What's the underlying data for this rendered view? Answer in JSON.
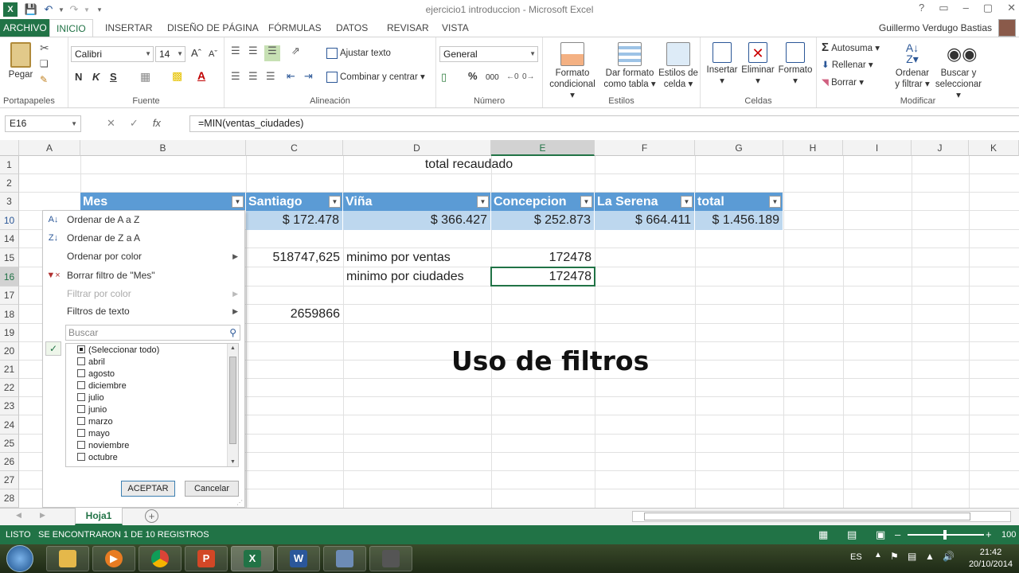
{
  "window": {
    "title": "ejercicio1 introduccion - Microsoft Excel",
    "controls": [
      "?",
      "▭",
      "–",
      "▢",
      "✕"
    ]
  },
  "tabs": [
    "ARCHIVO",
    "INICIO",
    "INSERTAR",
    "DISEÑO DE PÁGINA",
    "FÓRMULAS",
    "DATOS",
    "REVISAR",
    "VISTA"
  ],
  "user": "Guillermo Verdugo Bastias",
  "ribbon": {
    "clipboard": {
      "paste": "Pegar",
      "group": "Portapapeles"
    },
    "font": {
      "name": "Calibri",
      "size": "14",
      "bold": "N",
      "italic": "K",
      "underline": "S",
      "group": "Fuente"
    },
    "alignment": {
      "wrap": "Ajustar texto",
      "merge": "Combinar y centrar",
      "group": "Alineación"
    },
    "number": {
      "format": "General",
      "percent": "%",
      "thousands": "000",
      "group": "Número"
    },
    "styles": {
      "conditional_1": "Formato",
      "conditional_2": "condicional",
      "table_1": "Dar formato",
      "table_2": "como tabla",
      "cell_1": "Estilos de",
      "cell_2": "celda",
      "group": "Estilos"
    },
    "cells": {
      "insert": "Insertar",
      "delete": "Eliminar",
      "format": "Formato",
      "group": "Celdas"
    },
    "editing": {
      "autosum": "Autosuma",
      "fill": "Rellenar",
      "clear": "Borrar",
      "sort_1": "Ordenar",
      "sort_2": "y filtrar",
      "find_1": "Buscar y",
      "find_2": "seleccionar",
      "group": "Modificar"
    }
  },
  "formula_bar": {
    "name_box": "E16",
    "fx": "fx",
    "formula": "=MIN(ventas_ciudades)"
  },
  "columns": [
    "A",
    "B",
    "C",
    "D",
    "E",
    "F",
    "G",
    "H",
    "I",
    "J",
    "K"
  ],
  "rows": [
    "1",
    "2",
    "3",
    "10",
    "14",
    "15",
    "16",
    "17",
    "18",
    "19",
    "20",
    "21",
    "22",
    "23",
    "24",
    "25",
    "26",
    "27",
    "28"
  ],
  "cells": {
    "title": "total recaudado",
    "headers": [
      "Mes",
      "Santiago",
      "Viña",
      "Concepcion",
      "La Serena",
      "total"
    ],
    "totals": [
      "$ 172.478",
      "$ 366.427",
      "$ 252.873",
      "$ 664.411",
      "$ 1.456.189"
    ],
    "c15": "518747,625",
    "d15": "minimo por ventas",
    "e15": "172478",
    "d16": "minimo por ciudades",
    "e16": "172478",
    "c18": "2659866"
  },
  "overlay_text": "Uso de filtros",
  "filter_menu": {
    "sort_az": "Ordenar de A a Z",
    "sort_za": "Ordenar de Z a A",
    "sort_color": "Ordenar por color",
    "clear_filter": "Borrar filtro de \"Mes\"",
    "filter_color": "Filtrar por color",
    "text_filters": "Filtros de texto",
    "search_placeholder": "Buscar",
    "items": [
      "(Seleccionar todo)",
      "abril",
      "agosto",
      "diciembre",
      "julio",
      "junio",
      "marzo",
      "mayo",
      "noviembre",
      "octubre"
    ],
    "ok": "ACEPTAR",
    "cancel": "Cancelar"
  },
  "sheet_tab": "Hoja1",
  "status": {
    "mode": "LISTO",
    "message": "SE ENCONTRARON 1 DE 10 REGISTROS",
    "zoom": "100"
  },
  "taskbar": {
    "lang": "ES",
    "time": "21:42",
    "date": "20/10/2014"
  },
  "colors": {
    "excel_green": "#217346",
    "table_header": "#5b9bd5",
    "table_total": "#bdd7ee"
  }
}
